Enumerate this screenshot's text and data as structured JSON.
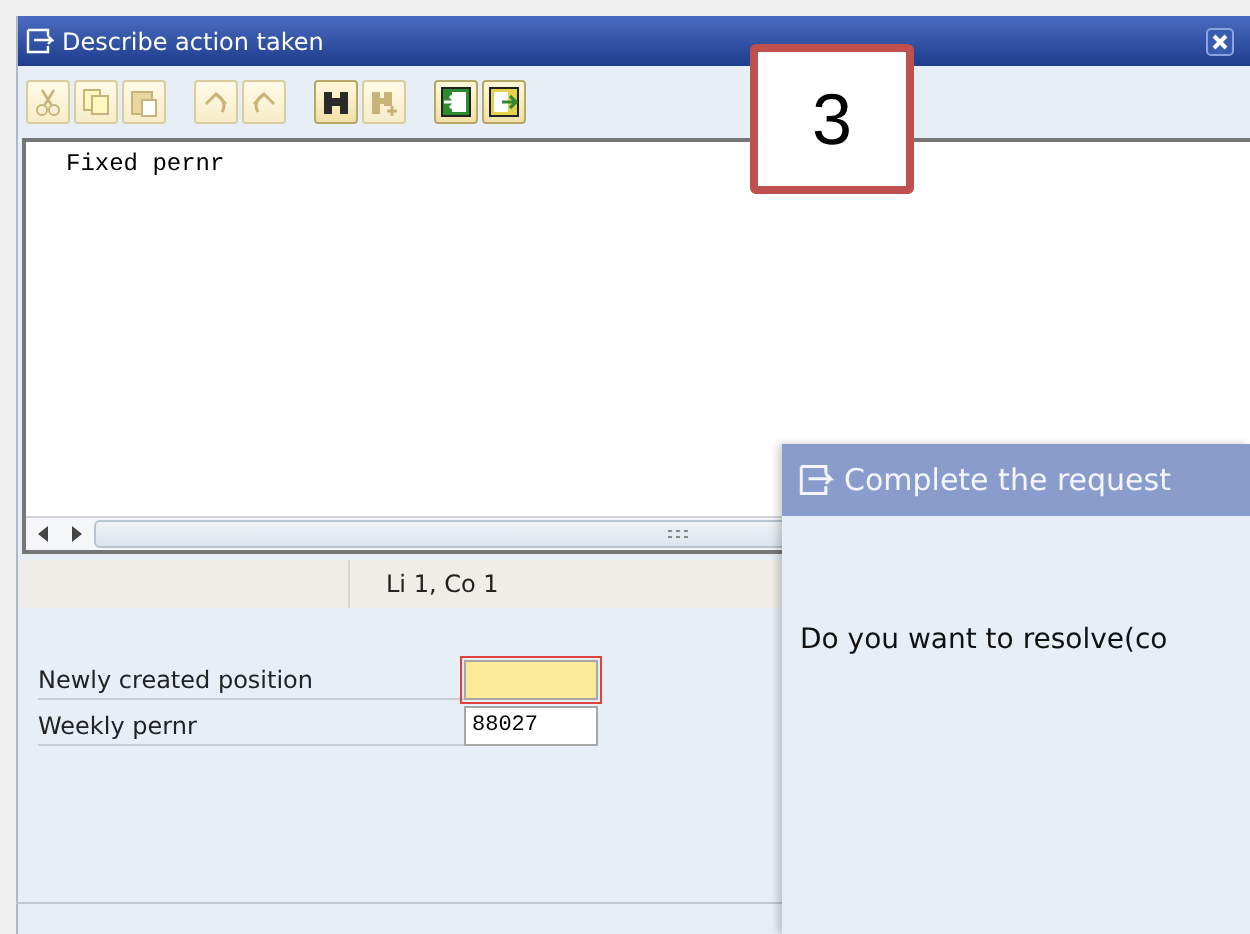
{
  "window": {
    "title": "Describe action taken"
  },
  "toolbar": [
    {
      "kind": "cut",
      "disabled": true
    },
    {
      "kind": "copy",
      "disabled": true
    },
    {
      "kind": "paste",
      "disabled": true
    },
    {
      "kind": "undo",
      "disabled": true
    },
    {
      "kind": "redo",
      "disabled": true
    },
    {
      "kind": "find",
      "disabled": false
    },
    {
      "kind": "find-next",
      "disabled": true
    },
    {
      "kind": "import",
      "disabled": false
    },
    {
      "kind": "export",
      "disabled": false
    }
  ],
  "editor": {
    "text": "Fixed pernr"
  },
  "status": {
    "position": "Li 1, Co 1"
  },
  "fields": [
    {
      "label": "Newly created position",
      "focused": true
    },
    {
      "label": "Weekly pernr",
      "value": "88027",
      "focused": false
    }
  ],
  "callout": {
    "number": "3"
  },
  "dialog": {
    "title": "Complete the request",
    "message": "Do you want to resolve(co"
  }
}
